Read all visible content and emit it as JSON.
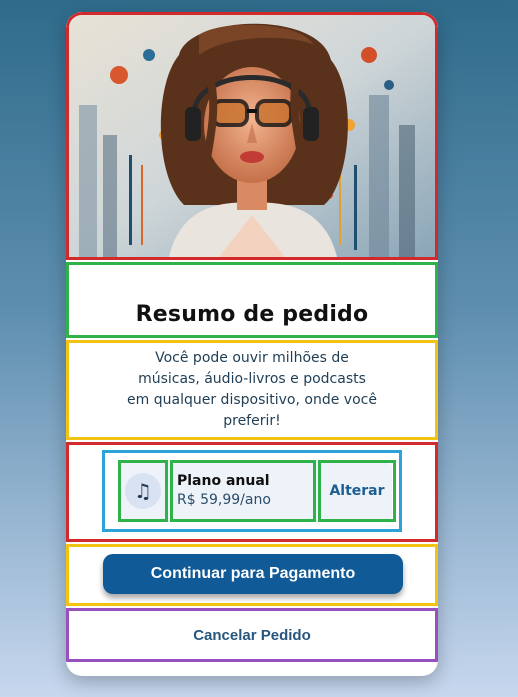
{
  "summary": {
    "title": "Resumo de pedido",
    "description": "Você pode ouvir milhões de músicas, áudio-livros e podcasts em qualquer dispositivo, onde você preferir!"
  },
  "plan": {
    "icon": "music-note-icon",
    "name": "Plano anual",
    "price": "R$ 59,99/ano",
    "change_label": "Alterar"
  },
  "actions": {
    "continue_label": "Continuar para Pagamento",
    "cancel_label": "Cancelar Pedido"
  },
  "colors": {
    "primary": "#0f5a97",
    "accent_text": "#1d5e93",
    "background_top": "#2f6b8b",
    "background_bottom": "#c7d7ee"
  },
  "hero": {
    "image": "illustration-woman-headphones-glasses"
  }
}
